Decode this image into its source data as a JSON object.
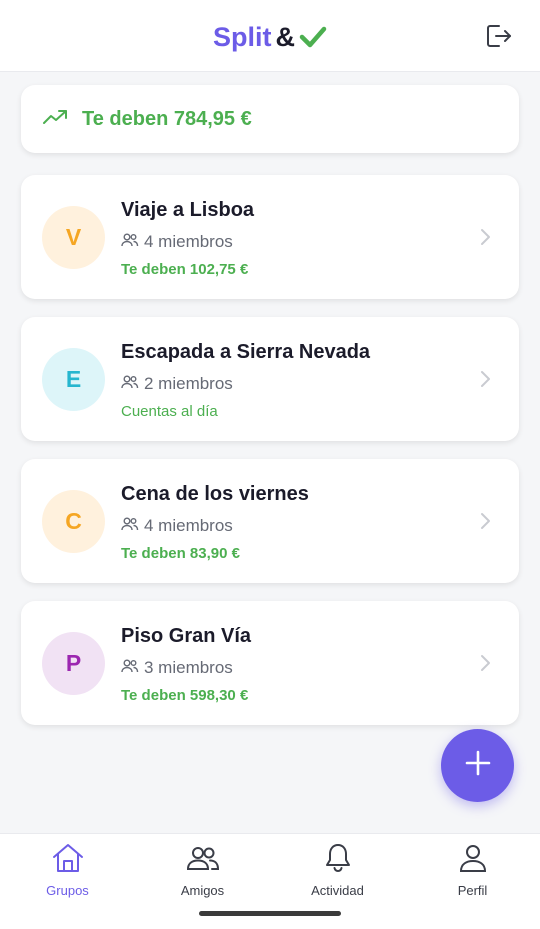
{
  "header": {
    "logo_split": "Split",
    "logo_amp": "&",
    "logout_icon": "logout-icon"
  },
  "summary": {
    "text": "Te deben 784,95 €",
    "icon": "trending-up-icon",
    "color": "#4caf50"
  },
  "groups": [
    {
      "initial": "V",
      "name": "Viaje a Lisboa",
      "members": "4 miembros",
      "status": "Te deben 102,75 €",
      "avatar_bg": "#fff1dd",
      "avatar_fg": "#f5a623"
    },
    {
      "initial": "E",
      "name": "Escapada a Sierra Nevada",
      "members": "2 miembros",
      "status": "Cuentas al día",
      "avatar_bg": "#ddf5f9",
      "avatar_fg": "#26b6cf"
    },
    {
      "initial": "C",
      "name": "Cena de los viernes",
      "members": "4 miembros",
      "status": "Te deben 83,90 €",
      "avatar_bg": "#fff1dd",
      "avatar_fg": "#f5a623"
    },
    {
      "initial": "P",
      "name": "Piso Gran Vía",
      "members": "3 miembros",
      "status": "Te deben 598,30 €",
      "avatar_bg": "#f1e2f4",
      "avatar_fg": "#9c27b0"
    }
  ],
  "fab": {
    "icon": "plus-icon",
    "color": "#6c5ce7"
  },
  "nav": [
    {
      "label": "Grupos",
      "icon": "home-icon",
      "active": true
    },
    {
      "label": "Amigos",
      "icon": "people-icon",
      "active": false
    },
    {
      "label": "Actividad",
      "icon": "bell-icon",
      "active": false
    },
    {
      "label": "Perfil",
      "icon": "user-icon",
      "active": false
    }
  ],
  "colors": {
    "accent": "#6c5ce7",
    "positive": "#4caf50"
  }
}
